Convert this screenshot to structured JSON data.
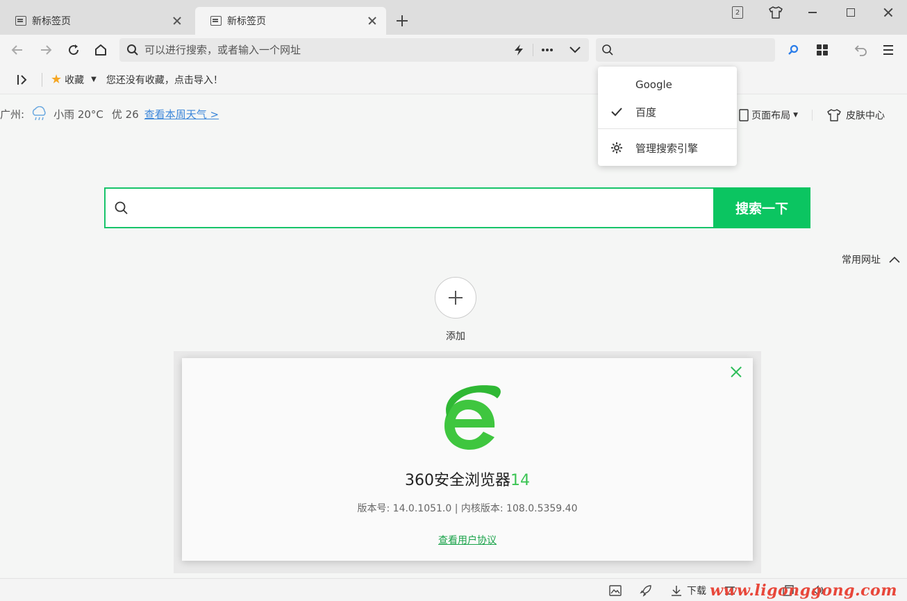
{
  "tabs": [
    {
      "title": "新标签页",
      "active": false
    },
    {
      "title": "新标签页",
      "active": true
    }
  ],
  "window": {
    "tab_count_badge": "2",
    "icons": [
      "tab-count-icon",
      "skin-shirt-icon",
      "minimize-icon",
      "maximize-icon",
      "close-icon"
    ]
  },
  "toolbar": {
    "address_placeholder": "可以进行搜索，或者输入一个网址",
    "address_actions": [
      "lightning-icon",
      "more-icon",
      "chevron-down-icon"
    ],
    "search_placeholder": ""
  },
  "bookmarks": {
    "favorites_label": "收藏",
    "empty_hint": "您还没有收藏，点击导入！"
  },
  "weather": {
    "city": "广州:",
    "condition": "小雨 20°C",
    "air_quality": "优 26",
    "week_link": "查看本周天气 >"
  },
  "page_tools": {
    "layout_label": "页面布局",
    "skin_label": "皮肤中心"
  },
  "main_search": {
    "placeholder": "",
    "button_label": "搜索一下"
  },
  "common_sites": {
    "label": "常用网址",
    "add_label": "添加"
  },
  "engine_menu": {
    "items": [
      {
        "label": "Google",
        "checked": false
      },
      {
        "label": "百度",
        "checked": true
      }
    ],
    "manage_label": "管理搜索引擎"
  },
  "about_dialog": {
    "product_name": "360安全浏览器",
    "product_version": "14",
    "version_line": "版本号: 14.0.1051.0 | 内核版本: 108.0.5359.40",
    "agreement_link": "查看用户协议",
    "brand_color": "#3bc454"
  },
  "statusbar": {
    "download_label": "下载",
    "watermark": "www.ligonggong.com"
  },
  "colors": {
    "accent_green": "#0bc561",
    "link_blue": "#3b86d9",
    "watermark_red": "#e8473a"
  }
}
